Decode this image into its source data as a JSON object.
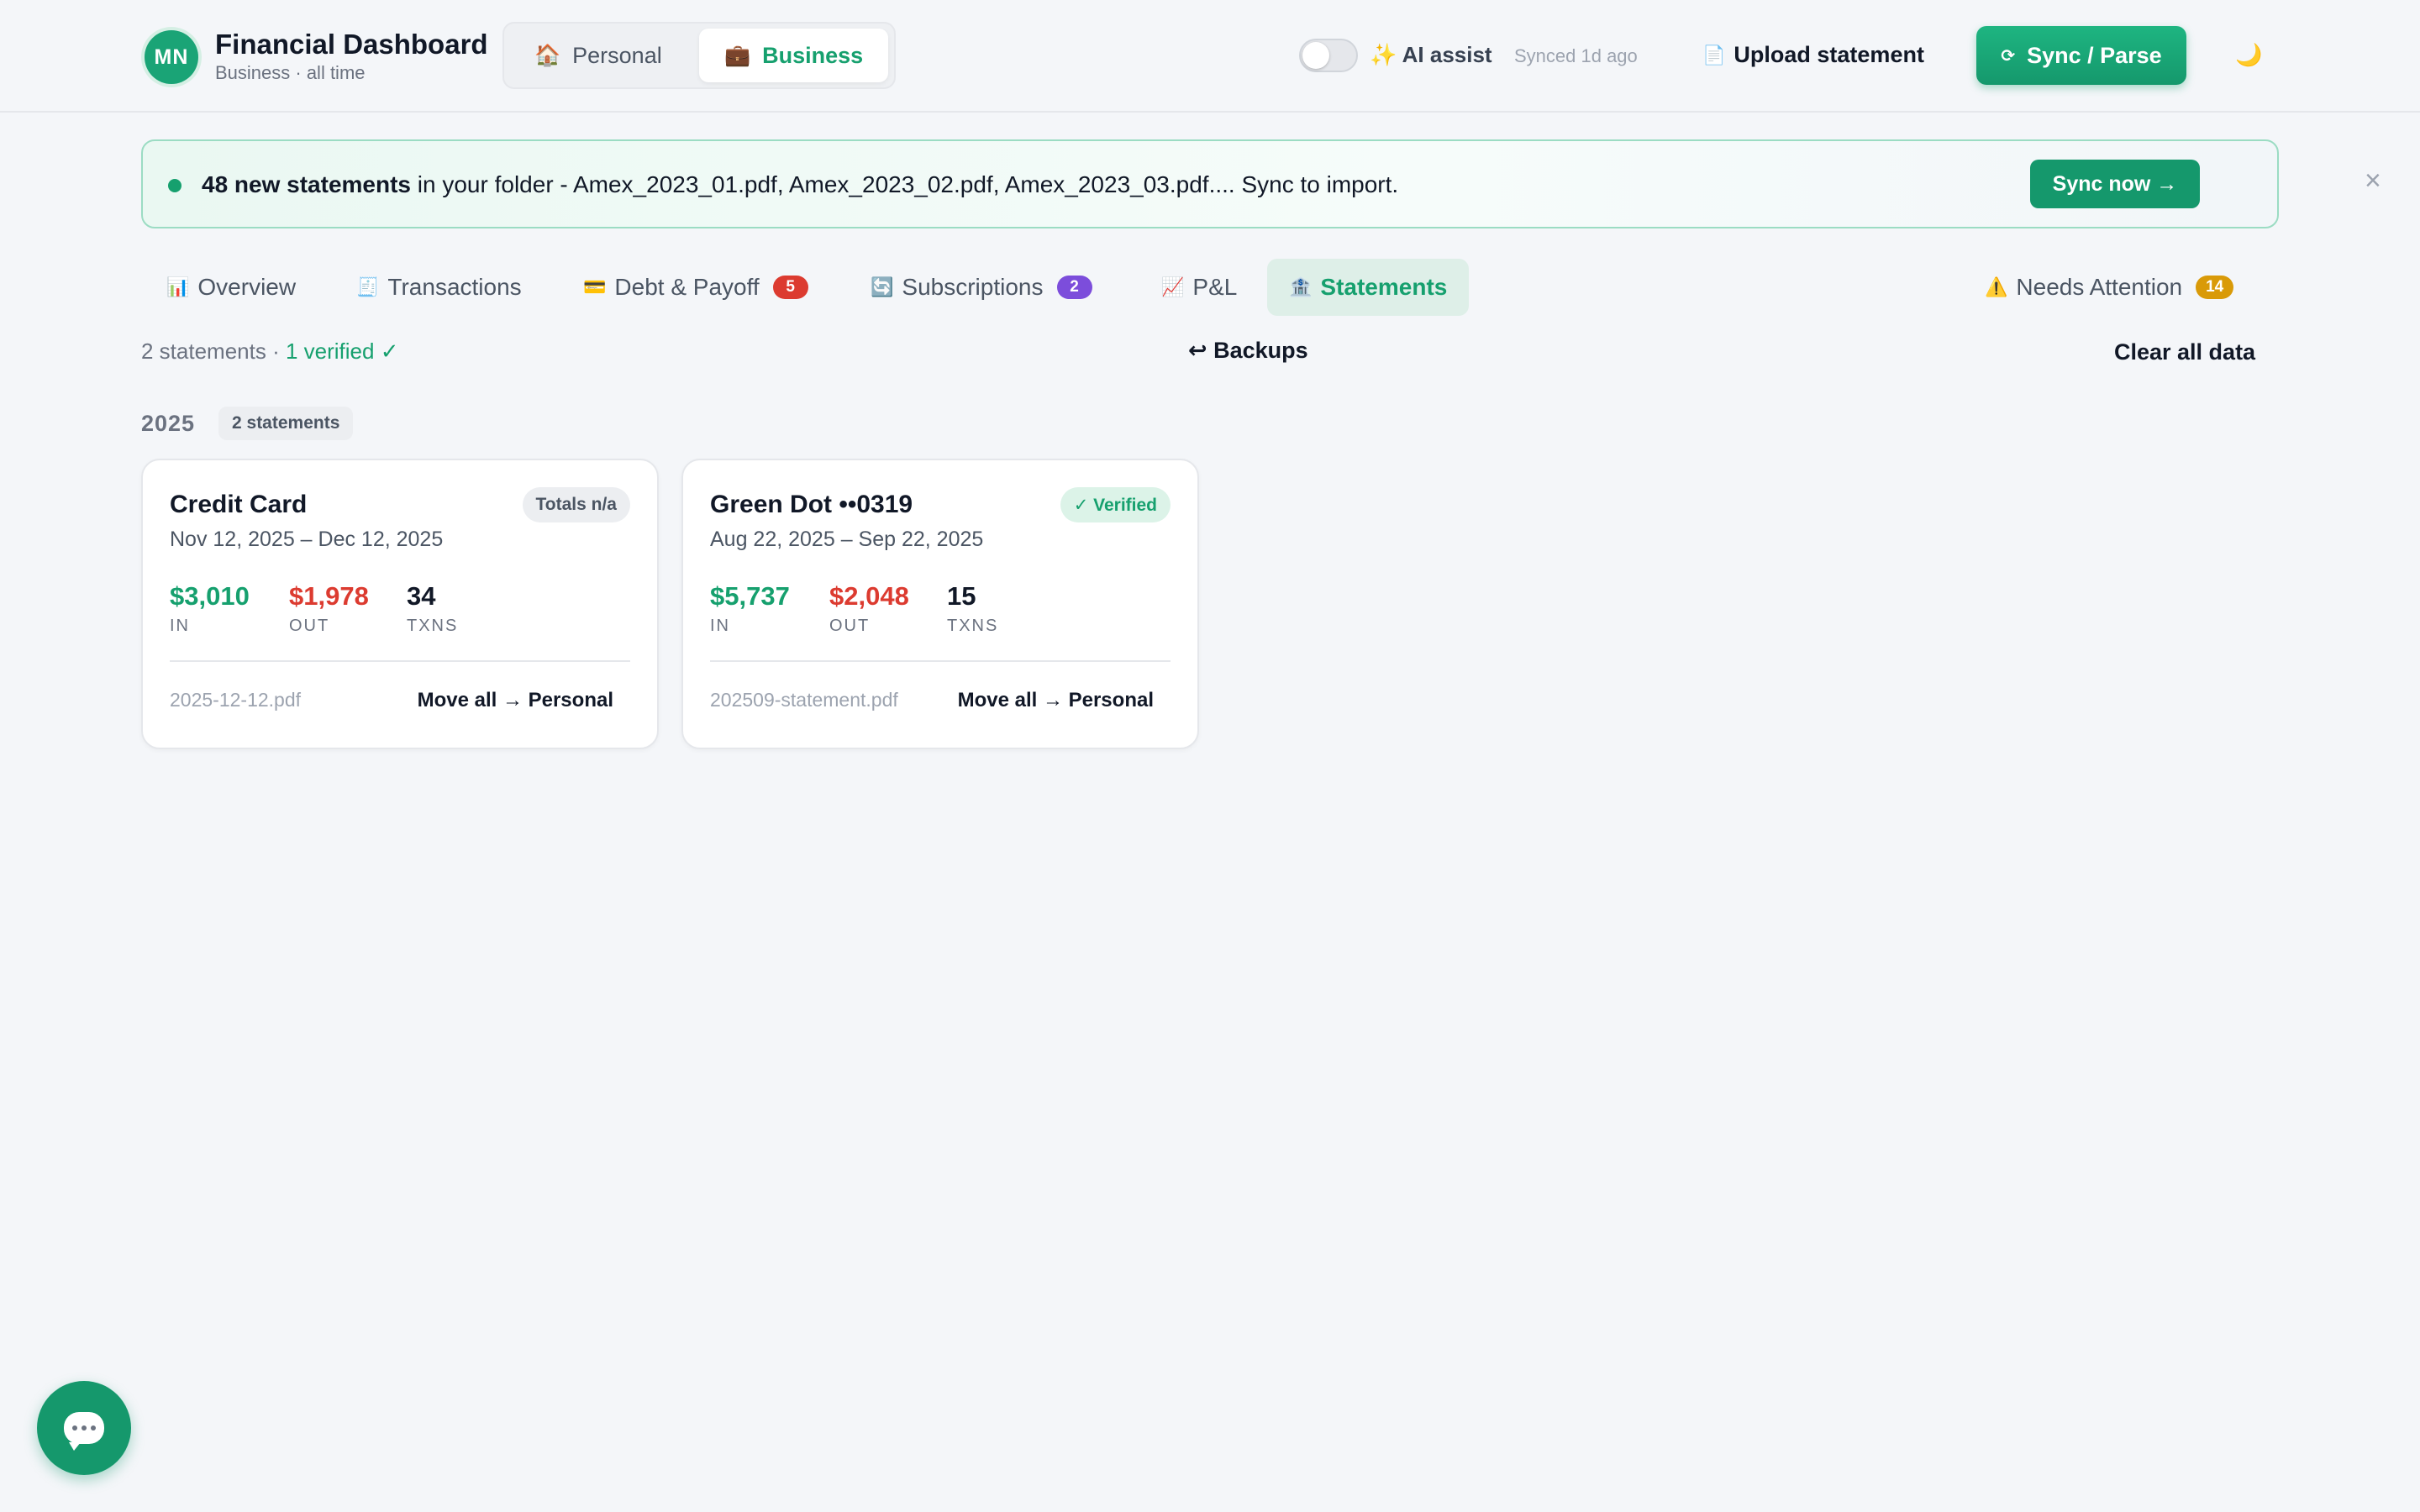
{
  "header": {
    "avatar_initials": "MN",
    "title": "Financial Dashboard",
    "subtitle": "Business · all time",
    "segments": [
      {
        "icon": "🏠",
        "label": "Personal",
        "active": false
      },
      {
        "icon": "💼",
        "label": "Business",
        "active": true
      }
    ],
    "ai_assist": {
      "icon": "✨",
      "label": "AI assist",
      "enabled": false
    },
    "synced": "Synced 1d ago",
    "upload": {
      "icon": "📄",
      "label": "Upload statement"
    },
    "sync_parse": {
      "icon": "⟳",
      "label": "Sync / Parse"
    },
    "theme_icon": "🌙"
  },
  "banner": {
    "strong": "48 new statements",
    "text": " in your folder - Amex_2023_01.pdf, Amex_2023_02.pdf, Amex_2023_03.pdf.... Sync to import.",
    "button": "Sync now →",
    "close": "×"
  },
  "tabs": [
    {
      "icon": "📊",
      "label": "Overview",
      "badge": ""
    },
    {
      "icon": "🧾",
      "label": "Transactions",
      "badge": ""
    },
    {
      "icon": "💳",
      "label": "Debt & Payoff",
      "badge": "5"
    },
    {
      "icon": "🔄",
      "label": "Subscriptions",
      "badge": "2"
    },
    {
      "icon": "📈",
      "label": "P&L",
      "badge": ""
    },
    {
      "icon": "🏦",
      "label": "Statements",
      "badge": ""
    },
    {
      "icon": "⚠️",
      "label": "Needs Attention",
      "badge": "14"
    }
  ],
  "subbar": {
    "count": "2 statements · ",
    "verified": "1 verified ✓",
    "backups": "↩ Backups",
    "clear": "Clear all data"
  },
  "group": {
    "year": "2025",
    "count": "2 statements"
  },
  "cards": [
    {
      "name": "Credit Card",
      "range": "Nov 12, 2025 – Dec 12, 2025",
      "pill": "Totals n/a",
      "in_value": "$3,010",
      "in_label": "IN",
      "out_value": "$1,978",
      "out_label": "OUT",
      "txns_value": "34",
      "txns_label": "TXNS",
      "file": "2025-12-12.pdf",
      "move": "Move all → Personal"
    },
    {
      "name": "Green Dot ••0319",
      "range": "Aug 22, 2025 – Sep 22, 2025",
      "pill": "✓ Verified",
      "in_value": "$5,737",
      "in_label": "IN",
      "out_value": "$2,048",
      "out_label": "OUT",
      "txns_value": "15",
      "txns_label": "TXNS",
      "file": "202509-statement.pdf",
      "move": "Move all → Personal"
    }
  ],
  "colors": {
    "accent": "#16a06e",
    "danger": "#dc3b30",
    "purple": "#7c4ddb",
    "amber": "#d99a08",
    "background": "#f4f6f9"
  }
}
